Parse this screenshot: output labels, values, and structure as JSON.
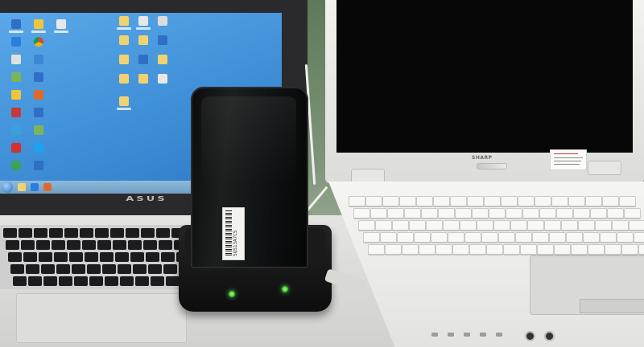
{
  "scene": {
    "left_laptop_brand": "ASUS",
    "right_laptop_brand": "SHARP",
    "device_serial_label": "SQS13A7CS",
    "led_color": "#56e04b",
    "desktop_color": "#3f8fd8"
  },
  "icons": [
    "desktop-app-icon",
    "folder-icon",
    "chrome-icon",
    "power-led-icon",
    "network-led-icon"
  ]
}
